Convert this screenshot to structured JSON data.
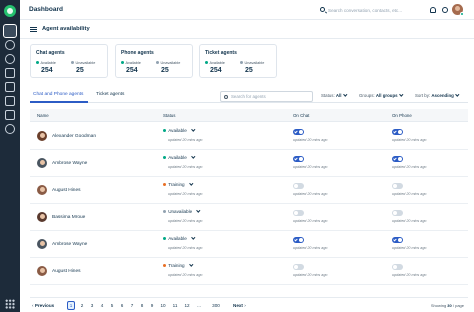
{
  "header": {
    "title": "Dashboard",
    "search_placeholder": "Search conversation, contacts, etc..."
  },
  "page": {
    "title": "Agent availability"
  },
  "summary_cards": [
    {
      "title": "Chat agents",
      "available_label": "Available",
      "available_count": "254",
      "unavailable_label": "Unavailable",
      "unavailable_count": "25"
    },
    {
      "title": "Phone agents",
      "available_label": "Available",
      "available_count": "254",
      "unavailable_label": "Unavailable",
      "unavailable_count": "25"
    },
    {
      "title": "Ticket agents",
      "available_label": "Available",
      "available_count": "254",
      "unavailable_label": "Unavailable",
      "unavailable_count": "25"
    }
  ],
  "tabs": [
    {
      "label": "Chat and Phone agents",
      "active": true
    },
    {
      "label": "Ticket agents",
      "active": false
    }
  ],
  "filters": {
    "search_placeholder": "Search for agents",
    "status_label": "Status:",
    "status_value": "All",
    "groups_label": "Groups:",
    "groups_value": "All groups",
    "sort_label": "Sort by:",
    "sort_value": "Ascending"
  },
  "table": {
    "columns": [
      "Name",
      "Status",
      "On Chat",
      "On Phone"
    ],
    "rows": [
      {
        "name": "Alexander Goodman",
        "status": "Available",
        "status_color": "#00a886",
        "status_updated": "updated 20 mins ago",
        "chat_on": true,
        "chat_updated": "updated 20 mins ago",
        "phone_on": true,
        "phone_updated": "updated 20 mins ago",
        "avatar_color": "#6b3f2a"
      },
      {
        "name": "Ambrose Wayne",
        "status": "Available",
        "status_color": "#00a886",
        "status_updated": "updated 20 mins ago",
        "chat_on": true,
        "chat_updated": "updated 20 mins ago",
        "phone_on": true,
        "phone_updated": "updated 20 mins ago",
        "avatar_color": "#4a5560"
      },
      {
        "name": "August Hines",
        "status": "Training",
        "status_color": "#e86f25",
        "status_updated": "updated 20 mins ago",
        "chat_on": false,
        "chat_updated": "updated 20 mins ago",
        "phone_on": false,
        "phone_updated": "updated 20 mins ago",
        "avatar_color": "#8a5b45"
      },
      {
        "name": "Bassima Mroue",
        "status": "Unavailable",
        "status_color": "#92a2b1",
        "status_updated": "updated 20 mins ago",
        "chat_on": false,
        "chat_updated": "updated 20 mins ago",
        "phone_on": false,
        "phone_updated": "updated 20 mins ago",
        "avatar_color": "#5a3a2e"
      },
      {
        "name": "Ambrose Wayne",
        "status": "Available",
        "status_color": "#00a886",
        "status_updated": "updated 20 mins ago",
        "chat_on": true,
        "chat_updated": "updated 20 mins ago",
        "phone_on": true,
        "phone_updated": "updated 20 mins ago",
        "avatar_color": "#4a5560"
      },
      {
        "name": "August Hines",
        "status": "Training",
        "status_color": "#e86f25",
        "status_updated": "updated 20 mins ago",
        "chat_on": false,
        "chat_updated": "updated 20 mins ago",
        "phone_on": false,
        "phone_updated": "updated 20 mins ago",
        "avatar_color": "#8a5b45"
      }
    ]
  },
  "pagination": {
    "previous_label": "Previous",
    "next_label": "Next",
    "pages": [
      "1",
      "2",
      "3",
      "4",
      "5",
      "6",
      "7",
      "8",
      "9",
      "10",
      "11",
      "12",
      "...",
      "300"
    ],
    "current_page": "1",
    "showing_prefix": "Showing",
    "showing_count": "30",
    "showing_suffix": "/ page"
  },
  "icons": {
    "rail": [
      "logo-icon",
      "dashboard-icon",
      "conversations-icon",
      "contacts-icon",
      "knowledge-base-icon",
      "inbox-icon",
      "reports-icon",
      "campaigns-icon",
      "settings-icon",
      "apps-grid-icon"
    ],
    "header": [
      "search-icon",
      "bell-icon",
      "help-icon",
      "avatar"
    ]
  },
  "colors": {
    "accent": "#2c5cc5",
    "available": "#00a886",
    "unavailable": "#92a2b1",
    "training": "#e86f25",
    "rail_bg": "#1d2b3a"
  }
}
